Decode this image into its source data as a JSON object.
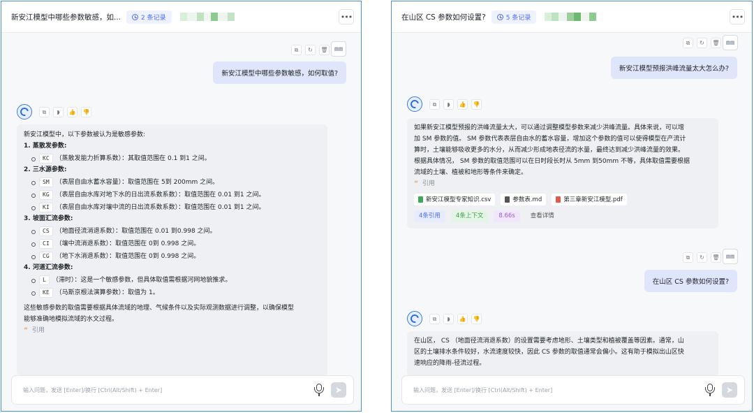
{
  "left": {
    "title": "新安江模型中哪些参数敏感，如...",
    "records": "2 条记录",
    "user_question": "新安江模型中哪些参数敏感，如何取值?",
    "answer": {
      "intro": "新安江模型中，以下参数被认为是敏感参数:",
      "sections": [
        {
          "title": "1. 蒸散发参数:",
          "items": [
            {
              "code": "KC",
              "text": "（蒸散发能力折算系数）：其取值范围在 0.1 到1 之间。"
            }
          ]
        },
        {
          "title": "2. 三水源参数:",
          "items": [
            {
              "code": "SM",
              "text": "（表层自由水蓄水容量）：取值范围在 5到 200mm 之间。"
            },
            {
              "code": "KG",
              "text": "（表层自由水库对地下水的日出流系数系数）：取值范围在 0.01 到1 之间。"
            },
            {
              "code": "KI",
              "text": "（表层自由水库对壤中流的日出流系数系数）：取值范围在 0.01 到1 之间。"
            }
          ]
        },
        {
          "title": "3. 坡面汇流参数:",
          "items": [
            {
              "code": "CS",
              "text": "（地面径流消退系数）：取值范围在 0.01 到0.998 之间。"
            },
            {
              "code": "CI",
              "text": "（壤中流消退系数）：取值范围在 0到 0.998 之间。"
            },
            {
              "code": "CG",
              "text": "（地下水消退系数）：取值范围在 0到 0.998 之间。"
            }
          ]
        },
        {
          "title": "4. 河道汇流参数:",
          "items": [
            {
              "code": "L",
              "text": "（滞时）：这是一个敏感参数，但具体取值需根据河网地貌推求。"
            },
            {
              "code": "KE",
              "text": "（马斯京根法演算参数）：取值为 1。"
            }
          ]
        }
      ],
      "outro_1": "这些敏感参数的取值需要根据具体流域的地理、气候条件以及实际观测数据进行调整，以确保模型",
      "outro_2": "能够准确地模拟流域的水文过程。",
      "quote_label": "引用"
    },
    "input_placeholder": "输入问题，发送 [Enter]/换行 [Ctrl(Alt/Shift) + Enter]"
  },
  "right": {
    "title": "在山区 CS 参数如何设置?",
    "records": "5 条记录",
    "user_question_1": "新安江模型预报洪峰流量太大怎么办?",
    "answer_1": {
      "lines": [
        "如果新安江模型预报的洪峰流量太大，可以通过调整模型参数来减少洪峰流量。具体来说，可以增",
        "加 SM 参数的值。 SM 参数代表表层自由水的蓄水容量，增加这个参数的值可以使得模型在产流计",
        "算时，土壤能够吸收更多的水分，从而减少形成地表径流的水量，最终达到减少洪峰流量的效果。",
        "根据具体情况， SM 参数的取值范围可以在日时段长时从 5mm 到50mm 不等，具体取值需要根据",
        "流域的土壤、植被和地形等条件来确定。"
      ],
      "quote_label": "引用",
      "files": [
        "新安江模型专家知识.csv",
        "参数表.md",
        "第三章新安江模型.pdf"
      ],
      "stat_refs": "4条引用",
      "stat_context": "4条上下文",
      "stat_time": "8.66s",
      "stat_detail": "查看详情"
    },
    "user_question_2": "在山区 CS 参数如何设置?",
    "answer_2": {
      "lines": [
        "在山区， CS （地面径流消退系数）的设置需要考虑地形、土壤类型和植被覆盖等因素。通常，山",
        "区的土壤排水条件较好，水流速度较快，因此 CS 参数的取值通常会偏小。这有助于模拟出山区快",
        "速响应的降雨-径流过程。"
      ]
    },
    "input_placeholder": "输入问题，发送 [Enter]/换行 [Ctrl(Alt/Shift) + Enter]"
  },
  "colors": {
    "accent": "#4d6bfe",
    "border": "#4a90d9",
    "user_bubble": "#dfe5fb",
    "bot_card": "#eef0f3"
  },
  "icons": {
    "toolbar": [
      "copy-icon",
      "refresh-icon",
      "delete-icon"
    ],
    "bot_actions": [
      "copy-icon",
      "speaker-icon",
      "thumbs-up-icon",
      "thumbs-down-icon"
    ],
    "input": [
      "mic-icon",
      "send-icon"
    ]
  }
}
